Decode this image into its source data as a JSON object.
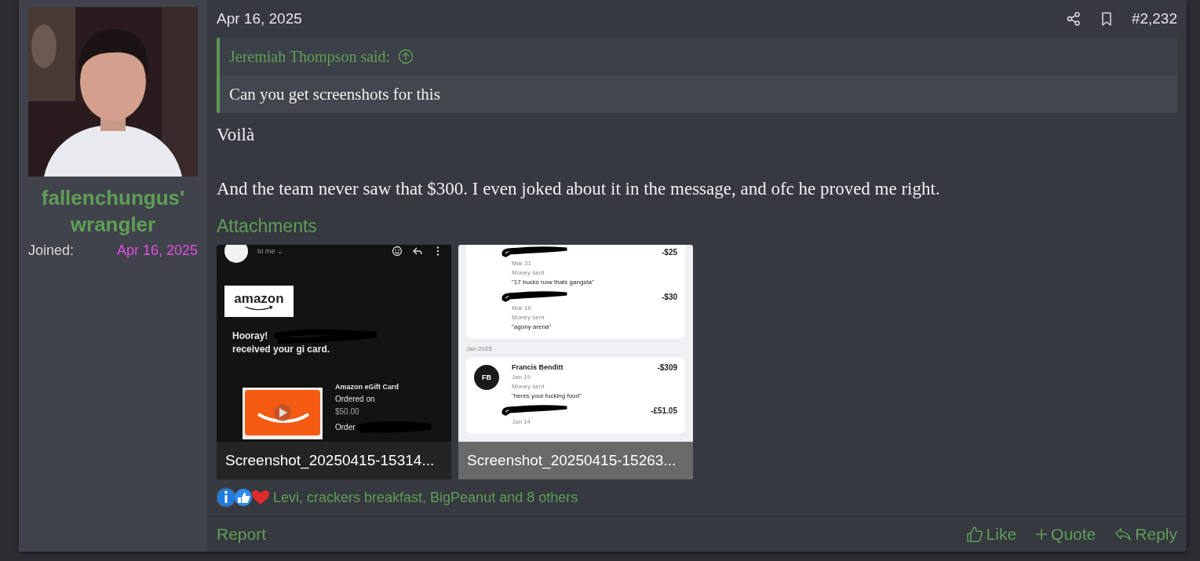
{
  "author": {
    "name": "fallenchungus' wrangler",
    "joined_label": "Joined:",
    "joined_date": "Apr 16, 2025"
  },
  "post": {
    "date": "Apr 16, 2025",
    "number": "#2,232"
  },
  "quote": {
    "author": "Jeremiah Thompson said:",
    "text": "Can you get screenshots for this"
  },
  "body": [
    "Voilà",
    "And the team never saw that $300. I even joked about it in the message, and ofc he proved me right."
  ],
  "attachments": {
    "heading": "Attachments",
    "items": [
      {
        "kind": "email",
        "caption": "Screenshot_20250415-15314...",
        "recipient": "to me ⌄",
        "logo": "amazon",
        "greeting": "Hooray!",
        "line": "received your gi card.",
        "product": "Amazon eGift Card",
        "ordered": "Ordered on",
        "price": "$50.00",
        "order": "Order"
      },
      {
        "kind": "payments",
        "caption": "Screenshot_20250415-15263...",
        "groups": [
          {
            "entries": [
              {
                "date": "Mar 31",
                "status": "Money sent",
                "note": "\"17 bucks now thats gangsta\"",
                "amount": "-$25"
              },
              {
                "date": "Mar 16",
                "status": "Money sent",
                "note": "\"agony arena\"",
                "amount": "-$30"
              }
            ]
          },
          {
            "month": "Jan 2025",
            "entries": [
              {
                "name": "Francis Benditt",
                "initials": "FB",
                "date": "Jan 19",
                "status": "Money sent",
                "note": "\"heres your fucking food\"",
                "amount": "-$309"
              },
              {
                "date": "Jan 14",
                "amount": "-£51.05"
              }
            ]
          }
        ]
      }
    ]
  },
  "reactions": {
    "text": "Levi, crackers breakfast, BigPeanut and 8 others"
  },
  "footer": {
    "report": "Report",
    "actions": [
      {
        "kind": "like",
        "label": "Like"
      },
      {
        "kind": "quote",
        "label": "Quote"
      },
      {
        "kind": "reply",
        "label": "Reply"
      }
    ]
  }
}
